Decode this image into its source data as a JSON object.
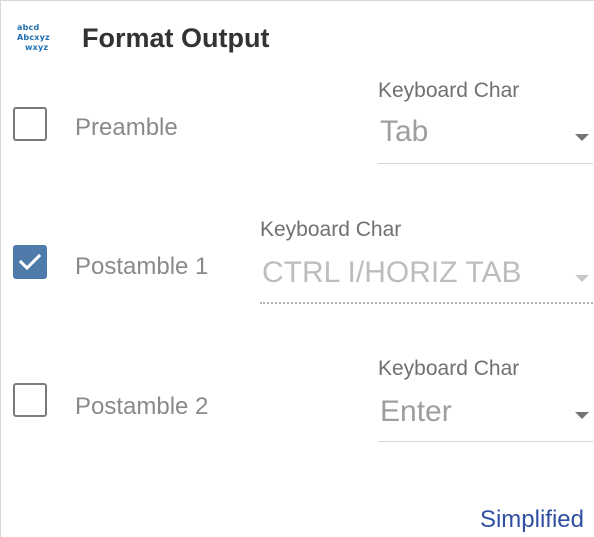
{
  "header": {
    "icon_name": "text-format-icon",
    "icon_lines": [
      "abcd",
      "Abcxyz",
      "wxyz"
    ],
    "title": "Format Output"
  },
  "rows": [
    {
      "checkbox_checked": false,
      "label": "Preamble",
      "field_label": "Keyboard Char",
      "field_value": "Tab",
      "field_enabled": true
    },
    {
      "checkbox_checked": true,
      "label": "Postamble 1",
      "field_label": "Keyboard Char",
      "field_value": "CTRL I/HORIZ TAB",
      "field_enabled": false
    },
    {
      "checkbox_checked": false,
      "label": "Postamble 2",
      "field_label": "Keyboard Char",
      "field_value": "Enter",
      "field_enabled": true
    }
  ],
  "footer": {
    "link_label": "Simplified"
  },
  "colors": {
    "accent": "#4f7bab",
    "link": "#2f4fa1",
    "icon": "#1f6fb2"
  }
}
